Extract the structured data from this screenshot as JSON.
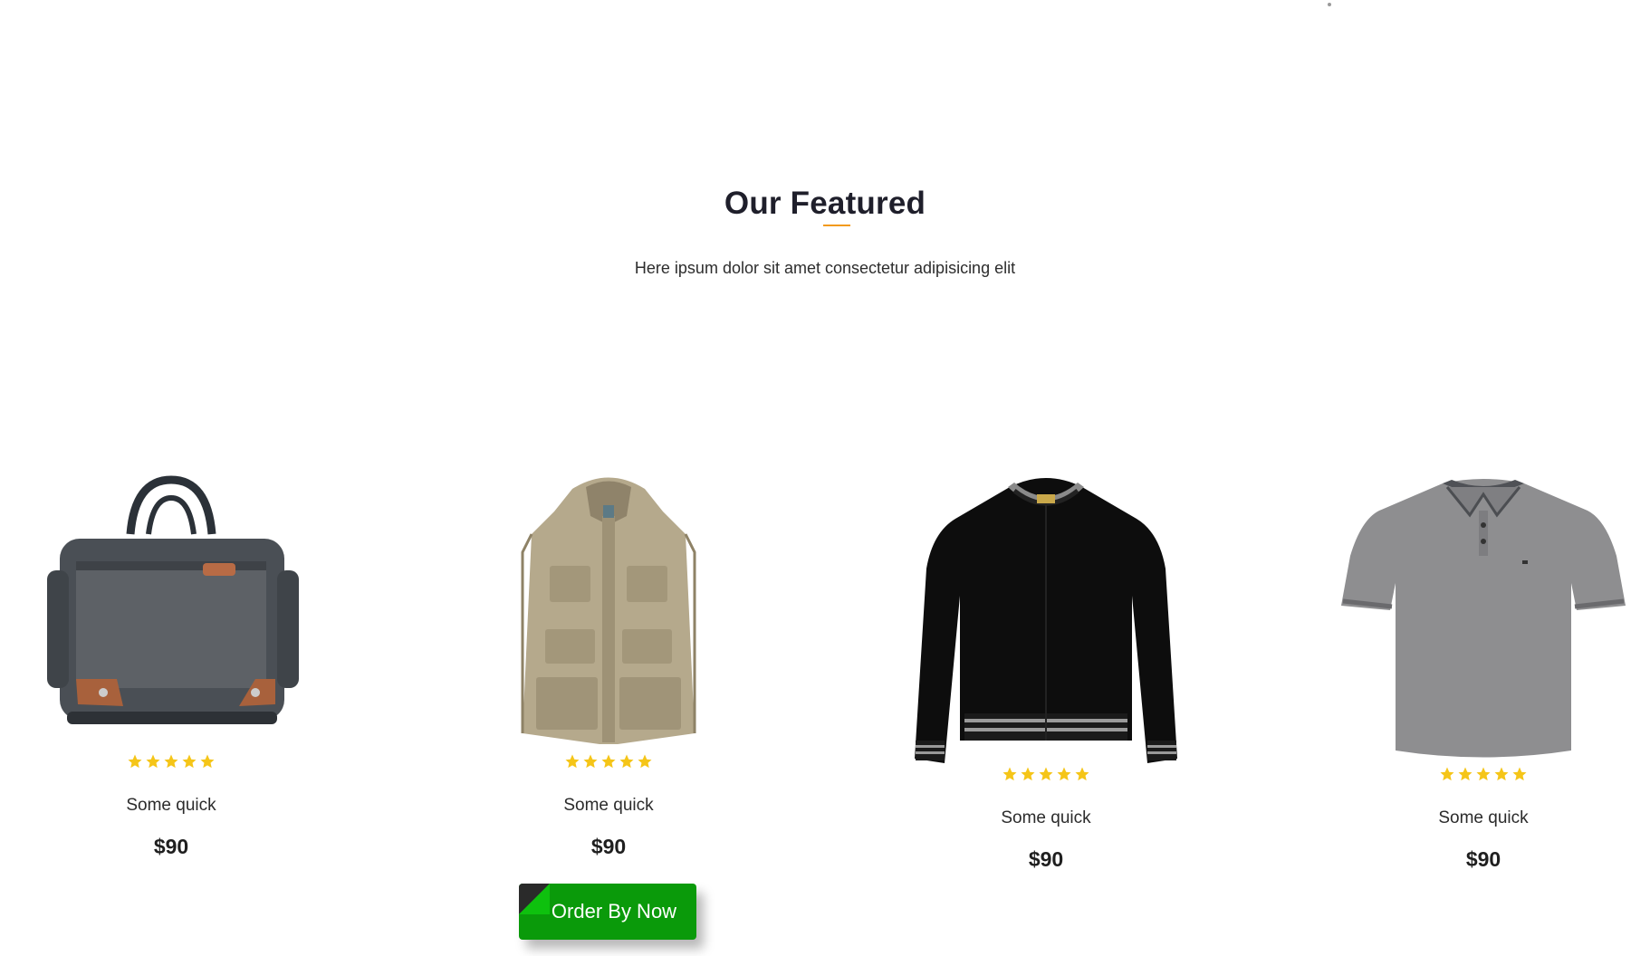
{
  "section": {
    "title": "Our Featured",
    "subtitle": "Here ipsum dolor sit amet consectetur adipisicing elit"
  },
  "colors": {
    "accent": "#f29a1d",
    "star": "#f5c518",
    "button": "#0a9a0a"
  },
  "products": [
    {
      "image": "messenger-bag",
      "rating": 5,
      "name": "Some quick",
      "price": "$90"
    },
    {
      "image": "khaki-vest",
      "rating": 5,
      "name": "Some quick",
      "price": "$90"
    },
    {
      "image": "black-bomber-jacket",
      "rating": 5,
      "name": "Some quick",
      "price": "$90"
    },
    {
      "image": "grey-polo-shirt",
      "rating": 5,
      "name": "Some quick",
      "price": "$90"
    }
  ],
  "order_button": {
    "label": "Order By Now"
  }
}
